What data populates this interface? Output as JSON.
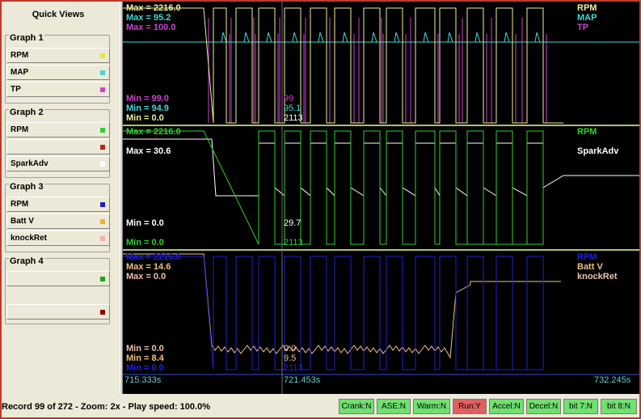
{
  "sidebar": {
    "title": "Quick Views",
    "groups": [
      {
        "title": "Graph 1",
        "items": [
          {
            "label": "RPM",
            "color": "#e8e83a"
          },
          {
            "label": "MAP",
            "color": "#40d8d8"
          },
          {
            "label": "TP",
            "color": "#d040d0"
          }
        ]
      },
      {
        "title": "Graph 2",
        "items": [
          {
            "label": "RPM",
            "color": "#30d030"
          },
          {
            "label": "",
            "color": "#c02020"
          },
          {
            "label": "SparkAdv",
            "color": "#ffffff"
          }
        ]
      },
      {
        "title": "Graph 3",
        "items": [
          {
            "label": "RPM",
            "color": "#2020c0"
          },
          {
            "label": "Batt V",
            "color": "#f0b030"
          },
          {
            "label": "knockRet",
            "color": "#f0b0b0"
          }
        ]
      },
      {
        "title": "Graph 4",
        "items": [
          {
            "label": "",
            "color": "#20a020"
          },
          {
            "label": "",
            "color": "#900000"
          }
        ]
      }
    ]
  },
  "graphs": [
    {
      "channels": [
        "RPM",
        "MAP",
        "TP"
      ],
      "colors": [
        "#f0f0a0",
        "#40d8d8",
        "#d040d0"
      ],
      "max": [
        "Max = 2216.0",
        "Max = 95.2",
        "Max = 100.0"
      ],
      "min": [
        "Min = 99.0",
        "Min = 94.9",
        "Min = 0.0"
      ],
      "min_colors": [
        "#d040d0",
        "#40d8d8",
        "#f0f0a0"
      ],
      "cursor_values": [
        "99",
        "95.1",
        "2113"
      ]
    },
    {
      "channels": [
        "RPM",
        "SparkAdv"
      ],
      "colors": [
        "#30d030",
        "#ffffff"
      ],
      "max": [
        "Max = 2216.0",
        "Max = 30.6"
      ],
      "min": [
        "Min = 0.0",
        "Min = 0.0"
      ],
      "min_colors": [
        "#ffffff",
        "#30d030"
      ],
      "cursor_values": [
        "29.7",
        "2113"
      ]
    },
    {
      "channels": [
        "RPM",
        "Batt V",
        "knockRet"
      ],
      "colors": [
        "#2020d0",
        "#f0c080",
        "#f0c0b0"
      ],
      "max": [
        "Max = 2216.0",
        "Max = 14.6",
        "Max = 0.0"
      ],
      "min": [
        "Min = 0.0",
        "Min = 8.4",
        "Min = 0.0"
      ],
      "min_colors": [
        "#f0c0b0",
        "#f0c080",
        "#2020d0"
      ],
      "cursor_values": [
        "0.0",
        "9.5",
        "2113"
      ]
    }
  ],
  "time_axis": {
    "start": "715.333s",
    "cursor": "721.453s",
    "end": "732.245s"
  },
  "status": {
    "record_text": "Record 99 of 272 - Zoom: 2x - Play speed: 100.0%",
    "flags": [
      {
        "label": "Crank:N",
        "color": "#70e070"
      },
      {
        "label": "ASE:N",
        "color": "#70e070"
      },
      {
        "label": "Warm:N",
        "color": "#70e070"
      },
      {
        "label": "Run:Y",
        "color": "#e06060"
      },
      {
        "label": "Accel:N",
        "color": "#70e070"
      },
      {
        "label": "Decel:N",
        "color": "#70e070"
      },
      {
        "label": "bit 7:N",
        "color": "#70e070"
      },
      {
        "label": "bit 8:N",
        "color": "#70e070"
      }
    ]
  }
}
